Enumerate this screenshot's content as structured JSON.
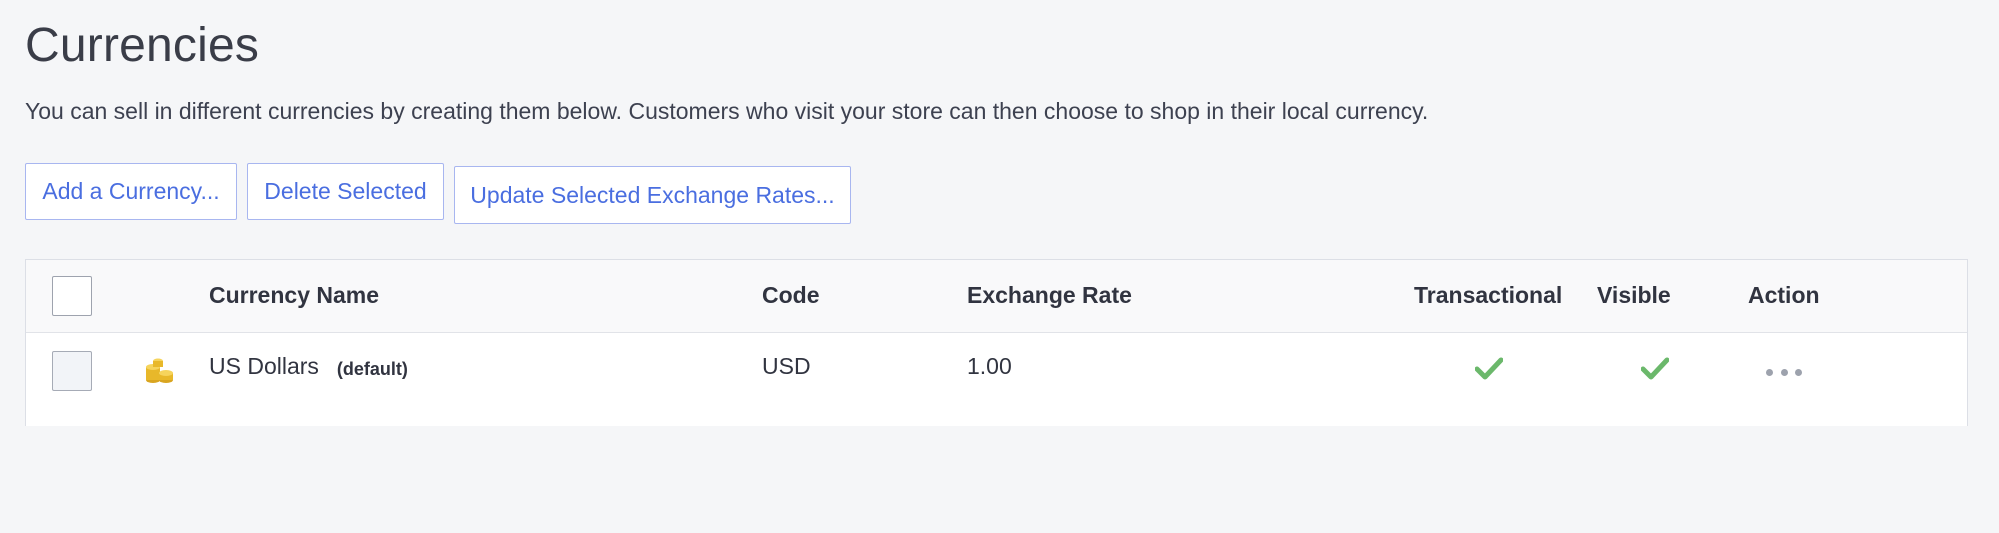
{
  "page": {
    "title": "Currencies",
    "description": "You can sell in different currencies by creating them below. Customers who visit your store can then choose to shop in their local currency."
  },
  "toolbar": {
    "add_label": "Add a Currency...",
    "delete_label": "Delete Selected",
    "update_label": "Update Selected Exchange Rates..."
  },
  "table": {
    "columns": [
      "Currency Name",
      "Code",
      "Exchange Rate",
      "Transactional",
      "Visible",
      "Action"
    ],
    "rows": [
      {
        "icon": "coins-icon",
        "name": "US Dollars",
        "tag": "(default)",
        "code": "USD",
        "exchange_rate": "1.00",
        "transactional": true,
        "visible": true,
        "action_icon": "more-actions-icon"
      }
    ]
  },
  "colors": {
    "accent": "#4a6ee0",
    "check_green": "#6bb86b",
    "background": "#f5f6f8"
  }
}
